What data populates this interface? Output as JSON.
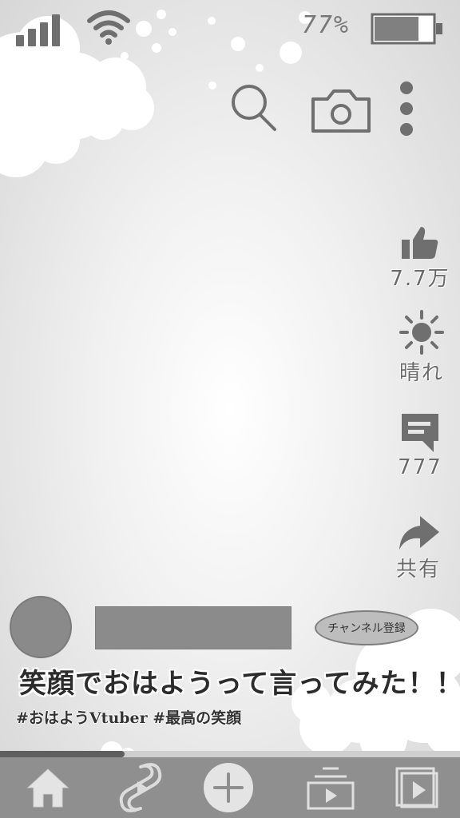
{
  "status_bar": {
    "battery_percent": "77%",
    "battery_level": 0.77,
    "signal_icon": "signal-bars-icon",
    "wifi_icon": "wifi-icon"
  },
  "top_actions": {
    "search_icon": "search-icon",
    "camera_icon": "camera-icon",
    "more_icon": "more-vertical-icon"
  },
  "rail": {
    "like": {
      "icon": "thumbs-up-icon",
      "label": "7.7万"
    },
    "weather": {
      "icon": "sun-icon",
      "label": "晴れ"
    },
    "comments": {
      "icon": "comment-icon",
      "label": "777"
    },
    "share": {
      "icon": "share-arrow-icon",
      "label": "共有"
    }
  },
  "channel": {
    "subscribe_label": "チャンネル登録"
  },
  "video": {
    "title": "笑顔でおはようって言ってみた！！",
    "hashtags": "#おはようVtuber #最高の笑顔",
    "progress": 0.27
  },
  "bottom_nav": {
    "home_icon": "home-icon",
    "shorts_icon": "shorts-icon",
    "create_icon": "plus-circle-icon",
    "subscriptions_icon": "subscriptions-icon",
    "library_icon": "library-play-icon"
  },
  "colors": {
    "icon_gray": "#6f6f6f",
    "nav_bg": "#8f8f8f",
    "progress_fill": "#5f5f5f"
  }
}
